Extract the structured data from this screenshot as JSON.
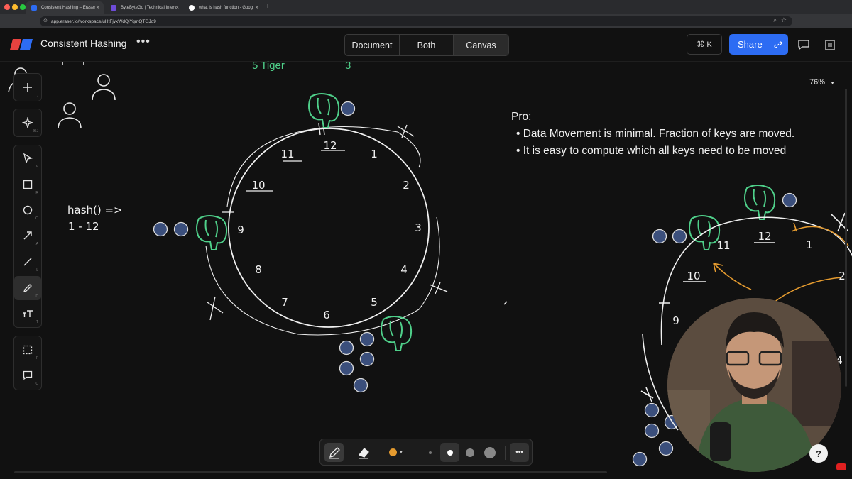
{
  "browser": {
    "tabs": [
      {
        "title": "Consistent Hashing – Eraser"
      },
      {
        "title": "ByteByteGo | Technical Interv"
      },
      {
        "title": "what is hash function - Googl"
      }
    ],
    "new_tab": "+",
    "url": "app.eraser.io/workspace/uHtFjyxWdQjYqmQTGJo9"
  },
  "header": {
    "doc_title": "Consistent Hashing",
    "more": "•••",
    "view_modes": [
      "Document",
      "Both",
      "Canvas"
    ],
    "active_mode": "Canvas",
    "shortcut": "⌘ K",
    "share_label": "Share"
  },
  "toolbar": {
    "add": {
      "icon": "plus-icon",
      "key": "/"
    },
    "ai": {
      "icon": "sparkle-icon",
      "key": "⌘J"
    },
    "tools": [
      {
        "name": "select-tool",
        "icon": "cursor-icon",
        "key": "V"
      },
      {
        "name": "rectangle-tool",
        "icon": "square-icon",
        "key": "R"
      },
      {
        "name": "ellipse-tool",
        "icon": "circle-icon",
        "key": "O"
      },
      {
        "name": "arrow-tool",
        "icon": "arrow-icon",
        "key": "A"
      },
      {
        "name": "line-tool",
        "icon": "line-icon",
        "key": "L"
      },
      {
        "name": "pen-tool",
        "icon": "pen-icon",
        "key": "D"
      },
      {
        "name": "text-tool",
        "icon": "text-icon",
        "key": "T"
      }
    ],
    "extra": [
      {
        "name": "frame-tool",
        "icon": "frame-icon",
        "key": "F"
      },
      {
        "name": "comment-tool",
        "icon": "comment-icon",
        "key": "C"
      }
    ]
  },
  "canvas": {
    "top_text": {
      "label": "5 Tiger",
      "value": "3"
    },
    "hash_text": {
      "line1": "hash() =>",
      "line2": "1 - 12"
    },
    "ring_numbers": [
      "12",
      "1",
      "2",
      "3",
      "4",
      "5",
      "6",
      "7",
      "8",
      "9",
      "10",
      "11"
    ],
    "notes": {
      "heading": "Pro:",
      "bullets": [
        "• Data Movement is minimal. Fraction of keys are moved.",
        "• It is easy to compute which all keys need to be moved"
      ]
    },
    "second_ring_numbers": [
      "12",
      "1",
      "2",
      "11",
      "10",
      "9",
      "4"
    ],
    "zoom": "76%",
    "colors": {
      "accent": "#2d6cf3",
      "elephant": "#4fd08a",
      "key_dot": "#3b4f7c",
      "tiger": "#4fd08a",
      "arrow": "#e59b2f"
    }
  },
  "drawbar": {
    "tools": [
      "pen-icon",
      "eraser-icon",
      "color-swatch",
      "size-tiny",
      "size-small",
      "size-medium",
      "size-large",
      "more-icon"
    ],
    "more_label": "•••"
  },
  "help": "?"
}
